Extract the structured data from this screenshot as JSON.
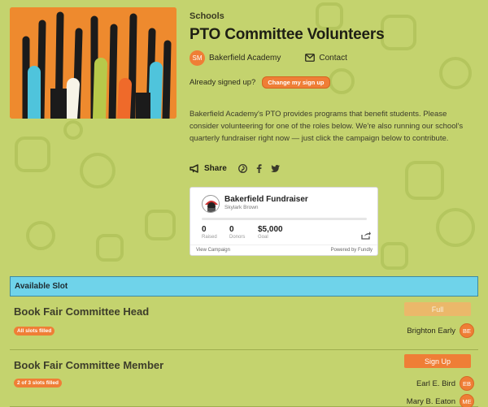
{
  "header": {
    "category": "Schools",
    "title": "PTO Committee Volunteers",
    "org": {
      "initials": "SM",
      "name": "Bakerfield Academy"
    },
    "contact_label": "Contact",
    "signed_up_prompt": "Already signed up?",
    "change_signup_label": "Change my sign up"
  },
  "description": "Bakerfield Academy's PTO provides programs that benefit students. Please consider volunteering for one of the roles below. We're also running our school's quarterly fundraiser right now — just click the campaign below to contribute.",
  "share": {
    "label": "Share",
    "icons": [
      "megaphone-icon",
      "pinterest-icon",
      "facebook-icon",
      "twitter-icon"
    ]
  },
  "fundraiser": {
    "title": "Bakerfield Fundraiser",
    "organizer": "Skylark Brown",
    "progress": 0,
    "stats": [
      {
        "value": "0",
        "label": "Raised"
      },
      {
        "value": "0",
        "label": "Donors"
      },
      {
        "value": "$5,000",
        "label": "Goal"
      }
    ],
    "view_label": "View Campaign",
    "powered_label": "Powered by Fundly"
  },
  "slots": {
    "header": "Available Slot",
    "items": [
      {
        "name": "Book Fair Committee Head",
        "status": "All slots filled",
        "button": "Full",
        "volunteers": [
          {
            "name": "Brighton Early",
            "initials": "BE"
          }
        ]
      },
      {
        "name": "Book Fair Committee Member",
        "status": "2 of 3 slots filled",
        "button": "Sign Up",
        "volunteers": [
          {
            "name": "Earl E. Bird",
            "initials": "EB"
          },
          {
            "name": "Mary B. Eaton",
            "initials": "ME"
          }
        ]
      }
    ]
  },
  "colors": {
    "background": "#c4d36e",
    "accent": "#ef7e36",
    "table_header": "#6fd3ea"
  }
}
